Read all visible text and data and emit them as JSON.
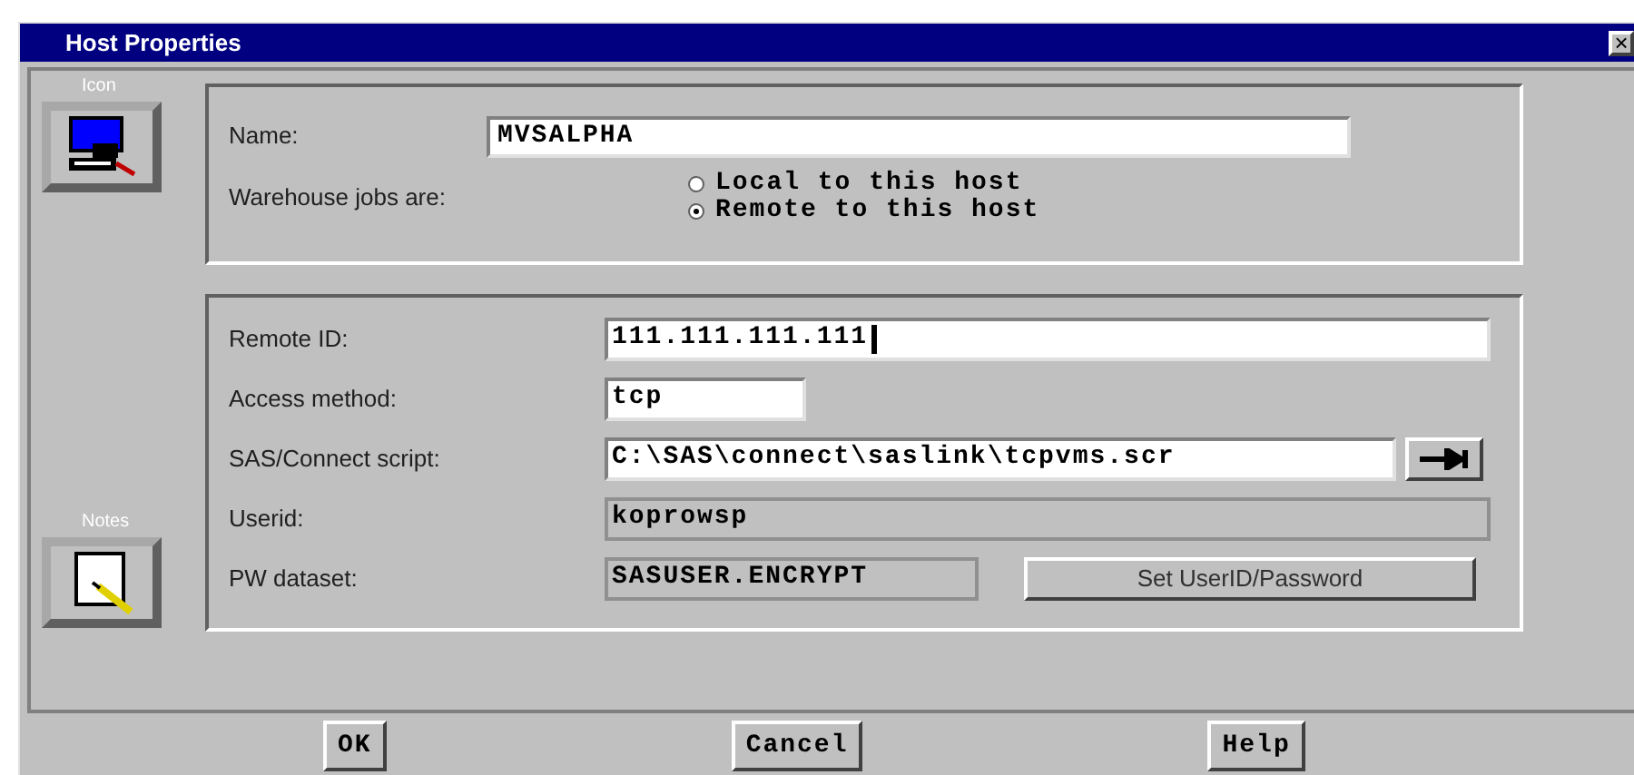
{
  "window": {
    "title": "Host Properties",
    "close": "×"
  },
  "side_buttons": [
    {
      "label": "Icon",
      "kind": "computer"
    },
    {
      "label": "Notes",
      "kind": "note"
    }
  ],
  "host": {
    "name_label": "Name:",
    "name_value": "MVSALPHA",
    "jobs_label": "Warehouse jobs are:",
    "options": [
      {
        "label": "Local to this host",
        "selected": false
      },
      {
        "label": "Remote to this host",
        "selected": true
      }
    ]
  },
  "connection": {
    "fields": [
      {
        "label": "Remote ID:",
        "value": "111.111.111.111",
        "kind": "wide",
        "disabled": false
      },
      {
        "label": "Access method:",
        "value": "tcp",
        "kind": "short",
        "disabled": false
      },
      {
        "label": "SAS/Connect script:",
        "value": "C:\\SAS\\connect\\saslink\\tcpvms.scr",
        "kind": "browse",
        "disabled": false
      },
      {
        "label": "Userid:",
        "value": "koprowsp",
        "kind": "wide",
        "disabled": true
      },
      {
        "label": "PW dataset:",
        "value": "SASUSER.ENCRYPT",
        "kind": "action",
        "disabled": true,
        "action": "Set UserID/Password"
      }
    ]
  },
  "buttons": [
    "OK",
    "Cancel",
    "Help"
  ]
}
